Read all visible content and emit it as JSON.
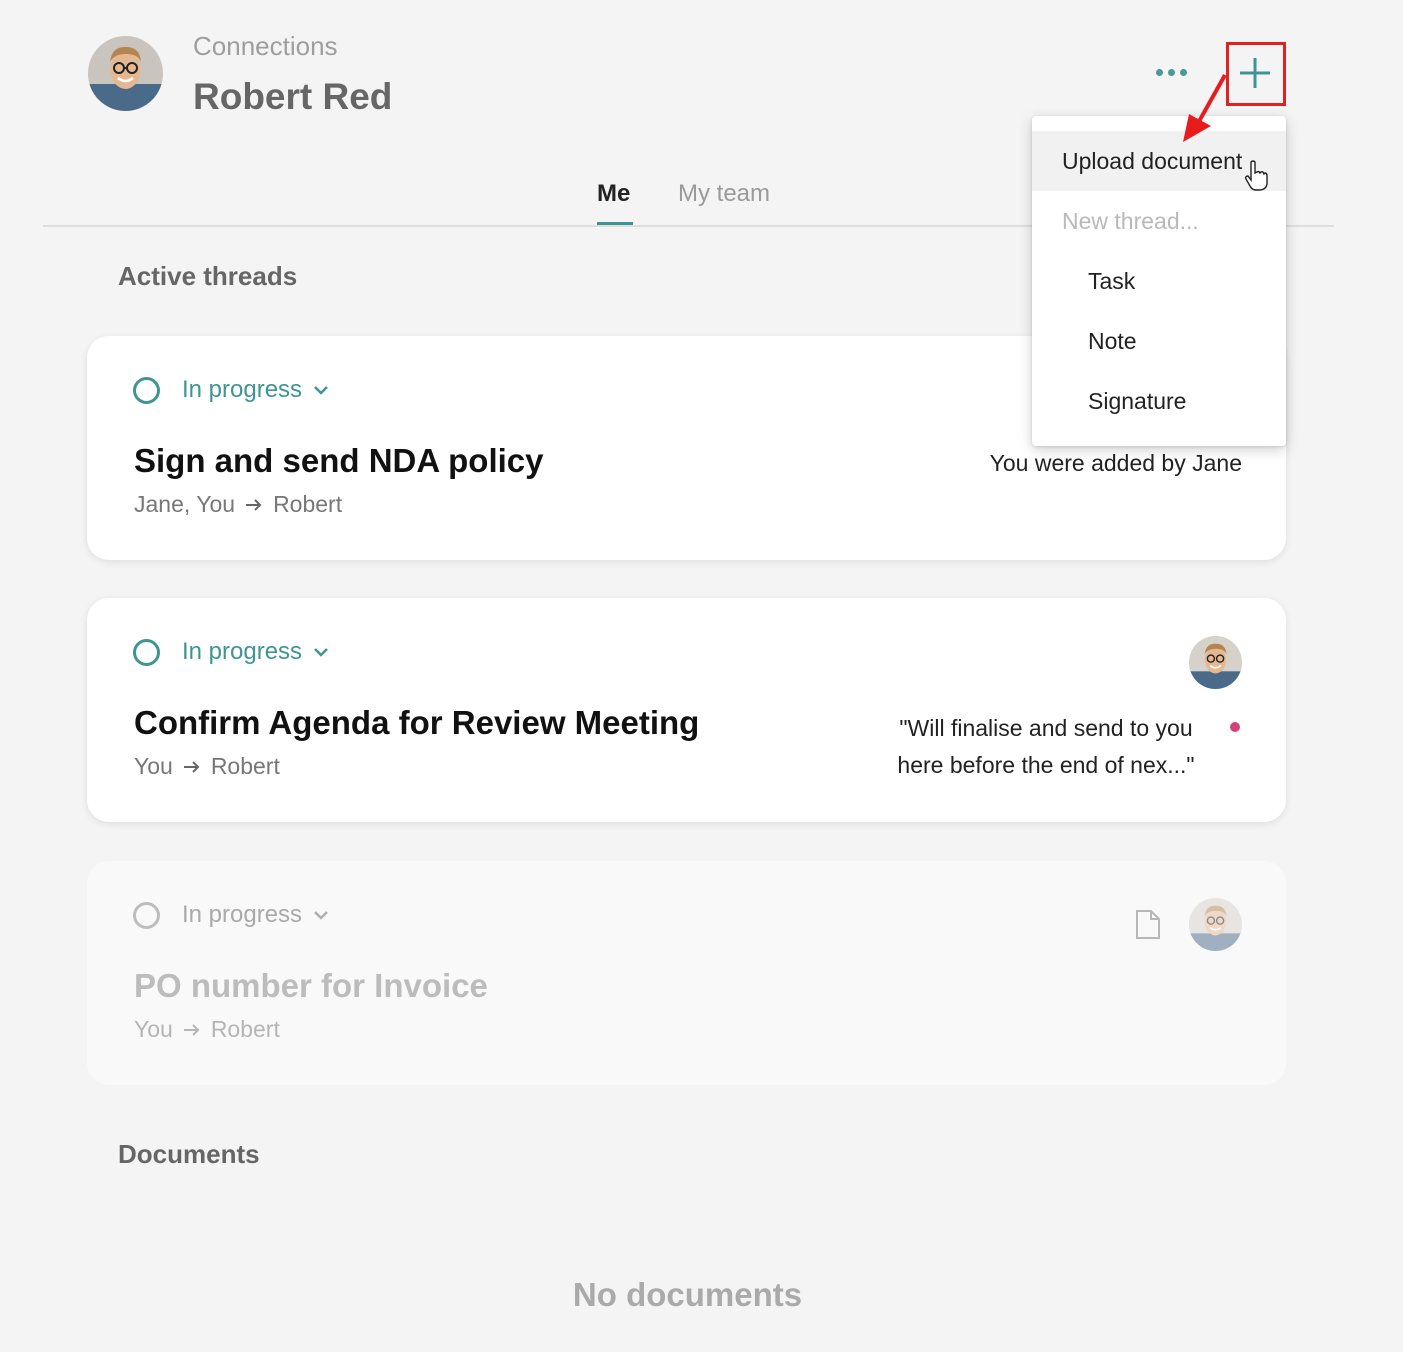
{
  "header": {
    "breadcrumb": "Connections",
    "title": "Robert Red",
    "more_icon": "more-horizontal-icon",
    "add_icon": "plus-icon"
  },
  "tabs": [
    {
      "label": "Me",
      "active": true
    },
    {
      "label": "My team",
      "active": false
    }
  ],
  "sections": {
    "active_threads": "Active threads",
    "documents": "Documents"
  },
  "threads": [
    {
      "status": "In progress",
      "title": "Sign and send NDA policy",
      "from": "Jane, You",
      "to": "Robert",
      "note": "You were added by Jane"
    },
    {
      "status": "In progress",
      "title": "Confirm Agenda for Review Meeting",
      "from": "You",
      "to": "Robert",
      "quote_line1": "\"Will finalise and send to you",
      "quote_line2": "here before the end of nex...\"",
      "unread": true
    },
    {
      "status": "In progress",
      "title": "PO number for Invoice",
      "from": "You",
      "to": "Robert",
      "faded": true,
      "attachment_icon": "document-icon"
    }
  ],
  "documents_empty": "No documents",
  "menu": {
    "upload": "Upload document",
    "new_thread_header": "New thread...",
    "items": [
      "Task",
      "Note",
      "Signature"
    ]
  },
  "colors": {
    "accent": "#3f9593",
    "highlight": "#e02222",
    "unread_dot": "#d4427a",
    "background": "#f4f4f4"
  }
}
